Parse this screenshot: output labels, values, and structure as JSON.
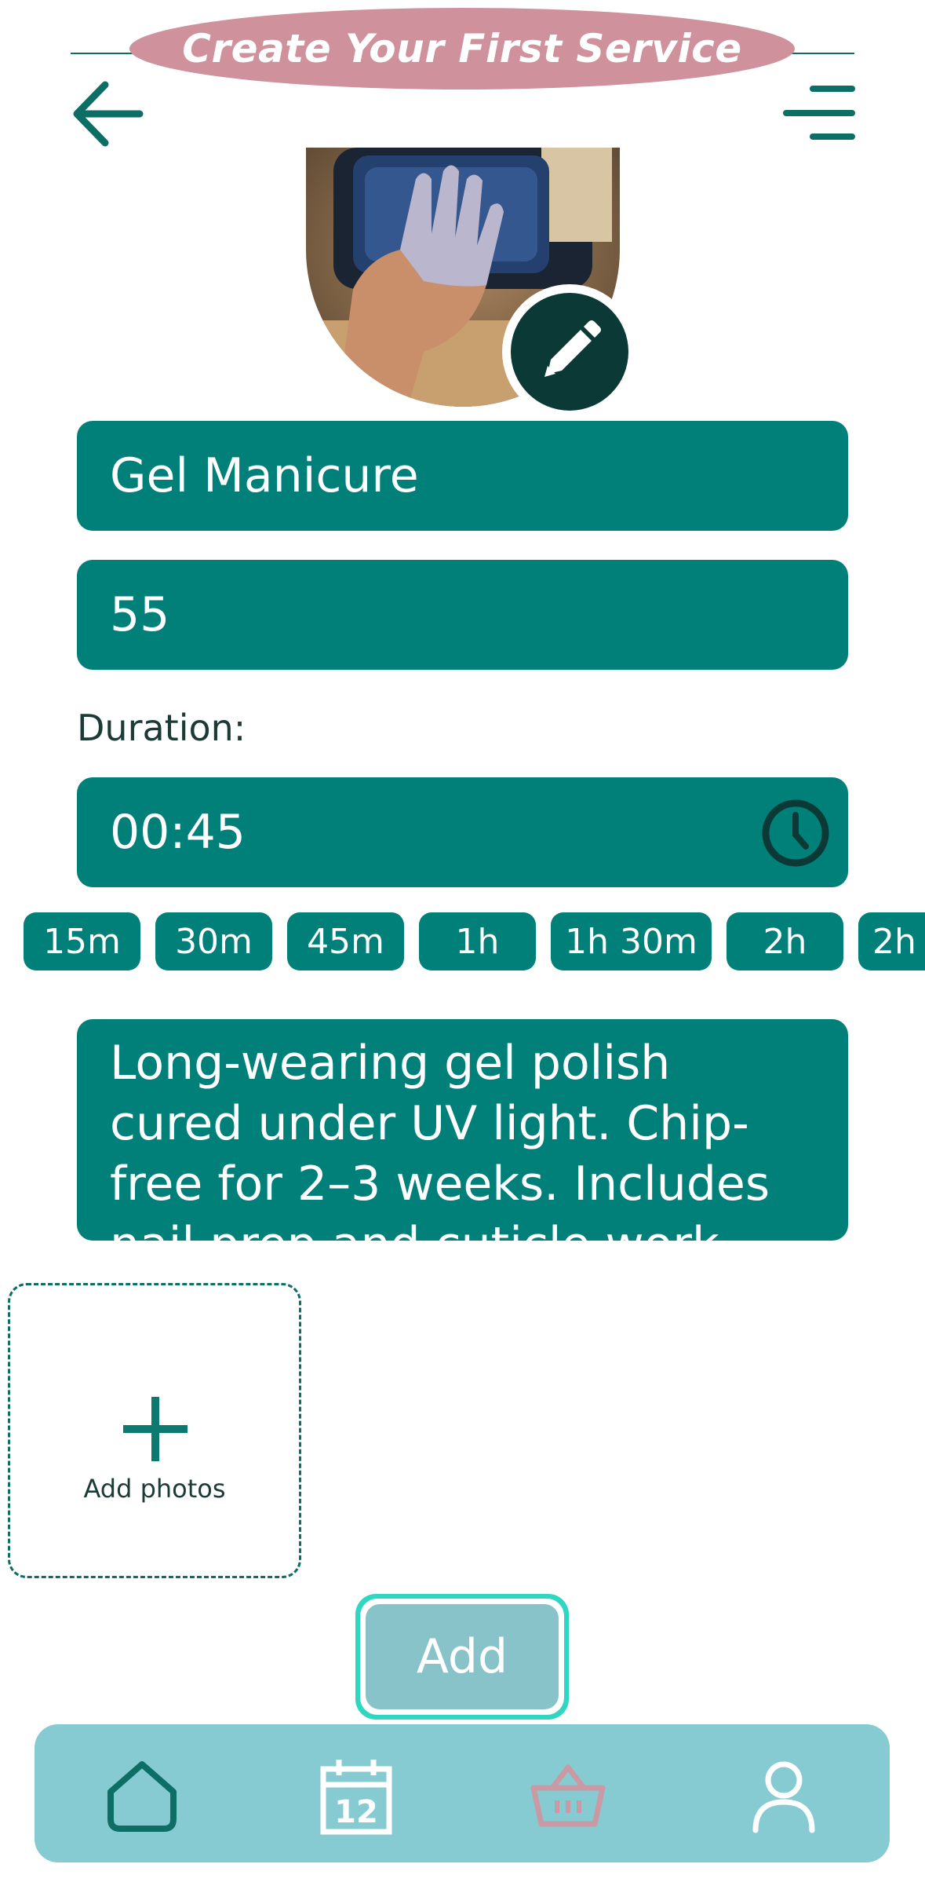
{
  "header": {
    "title": "Create Your First Service",
    "back_icon": "arrow-left-icon",
    "menu_icon": "menu-lines-icon"
  },
  "service": {
    "image_icon": "pencil-icon",
    "name_value": "Gel Manicure",
    "price_value": "55",
    "duration_label": "Duration:",
    "duration_value": "00:45",
    "duration_icon": "clock-icon",
    "duration_chips": [
      "15m",
      "30m",
      "45m",
      "1h",
      "1h 30m",
      "2h",
      "2h"
    ],
    "description": "Long-wearing gel polish cured under UV light. Chip-free for 2–3 weeks. Includes nail prep and cuticle work."
  },
  "photos": {
    "add_label": "Add photos",
    "icon": "plus-icon"
  },
  "actions": {
    "add_label": "Add"
  },
  "bottom_nav": {
    "items": [
      {
        "icon": "home-icon",
        "active": true
      },
      {
        "icon": "calendar-icon",
        "label": "12"
      },
      {
        "icon": "basket-icon"
      },
      {
        "icon": "profile-icon"
      }
    ]
  },
  "colors": {
    "teal": "#01807a",
    "dark_teal": "#0b3a36",
    "title_pill": "#cf929d",
    "nav_bg": "#87cbd2",
    "add_button": "#87c3c9",
    "add_button_ring": "#2fd6c2"
  }
}
